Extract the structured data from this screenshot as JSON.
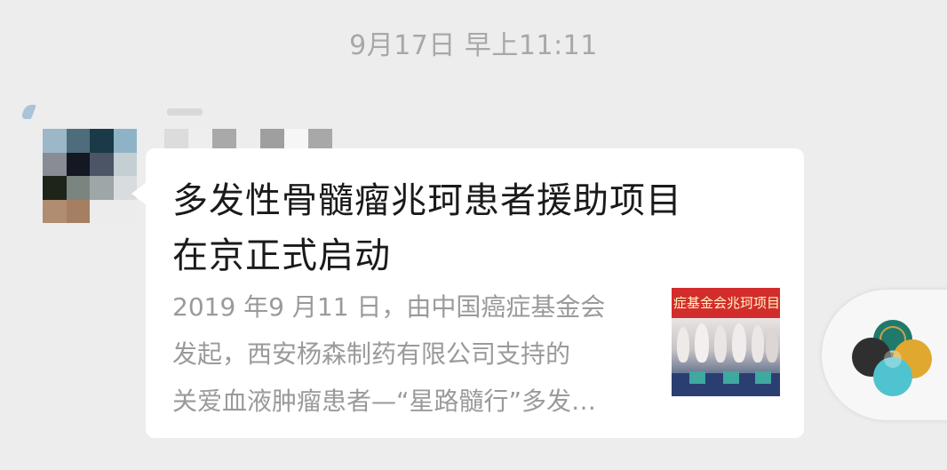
{
  "timestamp": "9月17日 早上11:11",
  "sender": {
    "name_obscured": true,
    "avatar_colors": [
      "#9bb7c8",
      "#4f6c7c",
      "#1b3a47",
      "#8fb3c6",
      "#898b95",
      "#131822",
      "#4b5565",
      "#c5cfd3",
      "#1e2419",
      "#7a8580",
      "#9ea6a8",
      "#d9dcde",
      "#b08c70",
      "#a67e62",
      "#ececec",
      "#ececec"
    ],
    "name_colors": [
      "#dcdcdc",
      "#eeeeee",
      "#a9a9a9",
      "#ededed",
      "#9f9f9f",
      "#f6f6f6",
      "#a8a8a8"
    ]
  },
  "card": {
    "title_line1": "多发性骨髓瘤兆珂患者援助项目",
    "title_line2": "在京正式启动",
    "summary_line1": "2019 年9 月11 日，由中国癌症基金会",
    "summary_line2": "发起，西安杨森制药有限公司支持的",
    "summary_line3": "关爱血液肿瘤患者—“星路髓行”多发…",
    "thumbnail": {
      "banner_text": "症基金会兆珂项目"
    }
  },
  "floating_widget": {
    "icon": "mini-program-floating-icon",
    "colors": [
      "#1f7a6b",
      "#2f2f2f",
      "#e0a82e",
      "#4fc3cf"
    ]
  }
}
